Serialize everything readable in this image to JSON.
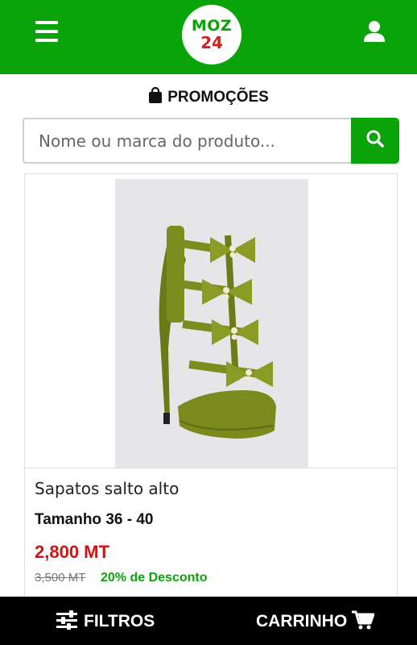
{
  "header": {
    "logo_line1": "MOZ",
    "logo_line2": "24",
    "menu_icon": "hamburger-menu-icon",
    "user_icon": "user-icon",
    "bg_color": "#0aa40a"
  },
  "section": {
    "icon": "shopping-bag-icon",
    "title": "PROMOÇÕES"
  },
  "search": {
    "placeholder": "Nome ou marca do produto...",
    "value": "",
    "button_icon": "search-icon"
  },
  "product": {
    "image_alt": "Sapatos salto alto",
    "name": "Sapatos salto alto",
    "size": "Tamanho 36 - 40",
    "price": "2,800 MT",
    "old_price": "3,500 MT",
    "discount": "20% de Desconto",
    "price_color": "#d01414",
    "discount_color": "#0aa40a"
  },
  "bottom_bar": {
    "filters_label": "FILTROS",
    "filters_icon": "sliders-icon",
    "cart_label": "CARRINHO",
    "cart_icon": "shopping-cart-icon"
  }
}
